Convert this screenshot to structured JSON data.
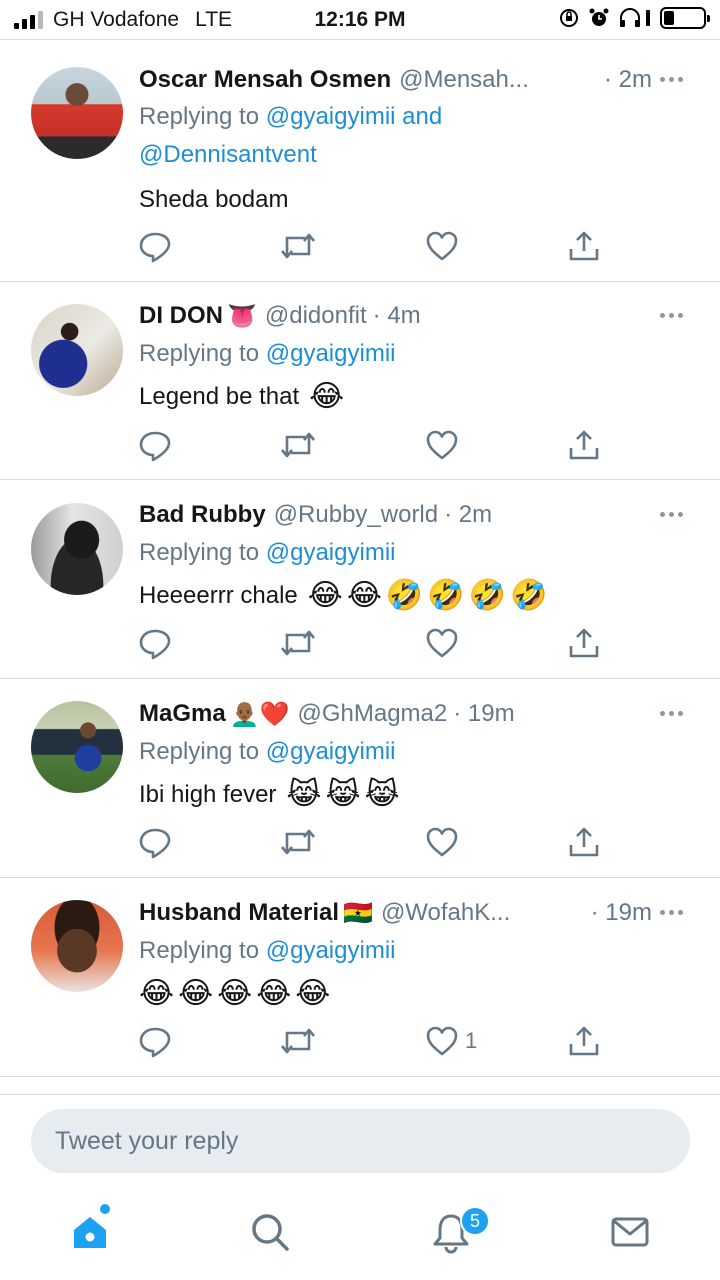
{
  "status_bar": {
    "carrier": "GH Vodafone",
    "network": "LTE",
    "time": "12:16 PM"
  },
  "tweets": [
    {
      "name": "Oscar Mensah Osmen",
      "handle": "@Mensah...",
      "time": "· 2m",
      "replying_prefix": "Replying to",
      "replying_to": "@gyaigyimii",
      "replying_join": "and",
      "replying_to_2": "@Dennisantvent",
      "text": "Sheda bodam",
      "emojis": []
    },
    {
      "name": "DI DON",
      "name_emoji": "👅",
      "handle": "@didonfit",
      "time": "· 4m",
      "replying_prefix": "Replying to",
      "replying_to": "@gyaigyimii",
      "text": "Legend be that",
      "emojis": [
        "😂"
      ]
    },
    {
      "name": "Bad Rubby",
      "handle": "@Rubby_world",
      "time": "· 2m",
      "replying_prefix": "Replying to",
      "replying_to": "@gyaigyimii",
      "text": "Heeeerrr chale",
      "emojis": [
        "😂",
        "😂",
        "🤣",
        "🤣",
        "🤣",
        "🤣"
      ]
    },
    {
      "name": "MaGma",
      "name_emoji": "👨🏾‍🦲❤️",
      "handle": "@GhMagma2",
      "time": "· 19m",
      "replying_prefix": "Replying to",
      "replying_to": "@gyaigyimii",
      "text": "Ibi high fever",
      "emojis": [
        "😹",
        "😹",
        "😹"
      ]
    },
    {
      "name": "Husband Material",
      "name_emoji": "🇬🇭",
      "handle": "@WofahK...",
      "time": "· 19m",
      "replying_prefix": "Replying to",
      "replying_to": "@gyaigyimii",
      "text": "",
      "emojis": [
        "😂",
        "😂",
        "😂",
        "😂",
        "😂"
      ],
      "like_count": "1"
    }
  ],
  "composer": {
    "placeholder": "Tweet your reply"
  },
  "tabbar": {
    "notifications_badge": "5"
  },
  "colors": {
    "accent": "#1da1f2",
    "mention": "#1d8ed6",
    "secondary_text": "#657786",
    "icon": "#657786"
  }
}
